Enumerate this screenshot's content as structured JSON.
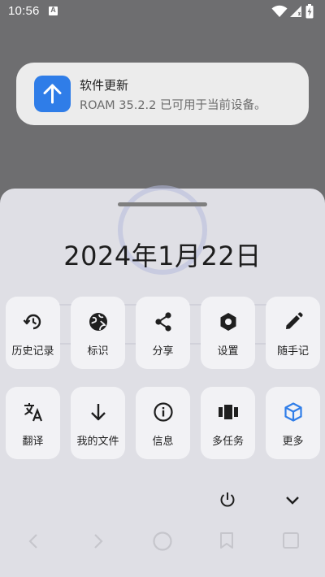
{
  "status_bar": {
    "time": "10:56",
    "icons": [
      "a-icon",
      "wifi-icon",
      "signal-icon",
      "battery-charging-icon"
    ]
  },
  "notification": {
    "icon": "arrow-up-icon",
    "title": "软件更新",
    "body": "ROAM 35.2.2 已可用于当前设备。",
    "accent": "#2f7de8"
  },
  "sheet": {
    "date": "2024年1月22日",
    "row1": [
      {
        "label": "历史记录",
        "icon": "history-icon"
      },
      {
        "label": "标识",
        "icon": "globe-icon"
      },
      {
        "label": "分享",
        "icon": "share-icon"
      },
      {
        "label": "设置",
        "icon": "settings-hexagon-icon"
      },
      {
        "label": "随手记",
        "icon": "pencil-icon"
      }
    ],
    "row2": [
      {
        "label": "翻译",
        "icon": "translate-icon"
      },
      {
        "label": "我的文件",
        "icon": "download-arrow-icon"
      },
      {
        "label": "信息",
        "icon": "info-icon"
      },
      {
        "label": "多任务",
        "icon": "multitask-icon"
      },
      {
        "label": "更多",
        "icon": "cube-icon",
        "color": "#2f7de8"
      }
    ],
    "actions": [
      "power-icon",
      "chevron-down-icon"
    ]
  },
  "nav_bar": [
    "back-icon",
    "forward-icon",
    "home-icon",
    "bookmark-icon",
    "tabs-icon"
  ]
}
